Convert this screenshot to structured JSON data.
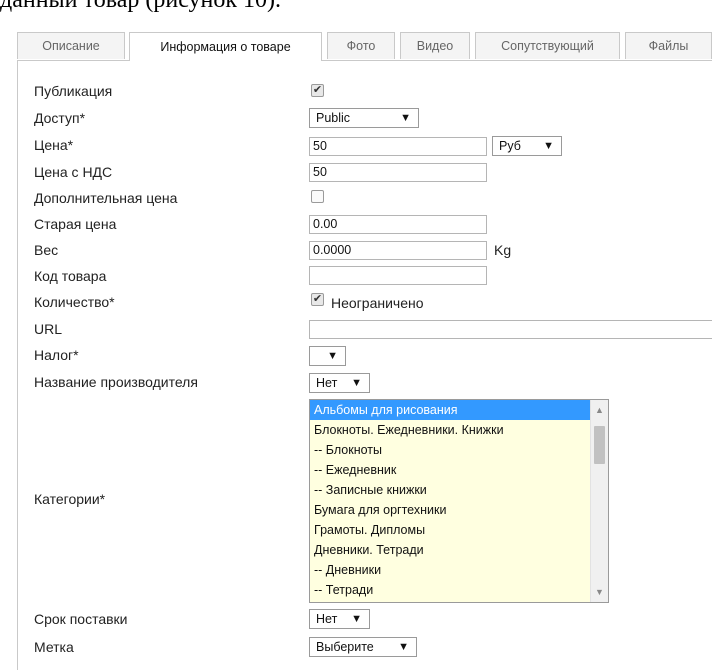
{
  "caption": "данный товар (рисунок 10).",
  "tabs": [
    "Описание",
    "Информация о товаре",
    "Фото",
    "Видео",
    "Сопутствующий",
    "Файлы"
  ],
  "form": {
    "publication": {
      "label": "Публикация",
      "checked": true,
      "mark": "✔"
    },
    "access": {
      "label": "Доступ*",
      "value": "Public"
    },
    "price": {
      "label": "Цена*",
      "value": "50",
      "currency": "Руб"
    },
    "price_vat": {
      "label": "Цена с НДС",
      "value": "50"
    },
    "extra_price": {
      "label": "Дополнительная цена",
      "checked": false
    },
    "old_price": {
      "label": "Старая цена",
      "value": "0.00"
    },
    "weight": {
      "label": "Вес",
      "value": "0.0000",
      "unit": "Kg"
    },
    "sku": {
      "label": "Код товара",
      "value": ""
    },
    "quantity": {
      "label": "Количество*",
      "checked": true,
      "mark": "✔",
      "option": "Неограничено"
    },
    "url": {
      "label": "URL",
      "value": ""
    },
    "tax": {
      "label": "Налог*",
      "value": ""
    },
    "manufacturer": {
      "label": "Название производителя",
      "value": "Нет"
    },
    "categories": {
      "label": "Категории*",
      "items": [
        "Альбомы для рисования",
        "Блокноты. Ежедневники. Книжки",
        "-- Блокноты",
        "-- Ежедневник",
        "-- Записные книжки",
        "Бумага для оргтехники",
        "Грамоты. Дипломы",
        "Дневники. Тетради",
        "-- Дневники",
        "-- Тетради"
      ],
      "selected_index": 0
    },
    "delivery": {
      "label": "Срок поставки",
      "value": "Нет"
    },
    "tag": {
      "label": "Метка",
      "value": "Выберите"
    }
  },
  "icons": {
    "dropdown": "▼",
    "scroll_up": "▲",
    "scroll_down": "▼"
  }
}
